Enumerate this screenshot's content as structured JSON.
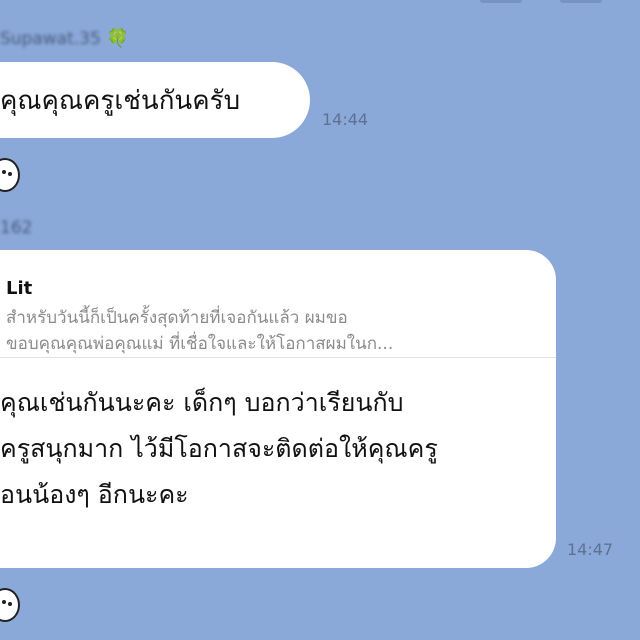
{
  "messages": [
    {
      "sender": "Supawat.35",
      "text": "คุณคุณครูเช่นกันครับ",
      "time": "14:44"
    },
    {
      "sender": "162",
      "quote": {
        "name": "Lit",
        "lines": [
          "สำหรับวันนี้ก็เป็นครั้งสุดท้ายที่เจอกันแล้ว ผมขอ",
          "ขอบคุณคุณพ่อคุณแม่ ที่เชื่อใจและให้โอกาสผมในก..."
        ]
      },
      "lines": [
        "คุณเช่นกันนะคะ เด็กๆ บอกว่าเรียนกับ",
        "ครูสนุกมาก ไว้มีโอกาสจะติดต่อให้คุณครู",
        "อนน้องๆ อีกนะคะ"
      ],
      "time": "14:47"
    }
  ],
  "icons": {
    "clover": "four-leaf-clover-icon",
    "avatar": "sticker-avatar-icon"
  },
  "colors": {
    "background": "#8aa8d8",
    "bubble": "#ffffff",
    "timestamp": "#5d7194"
  }
}
